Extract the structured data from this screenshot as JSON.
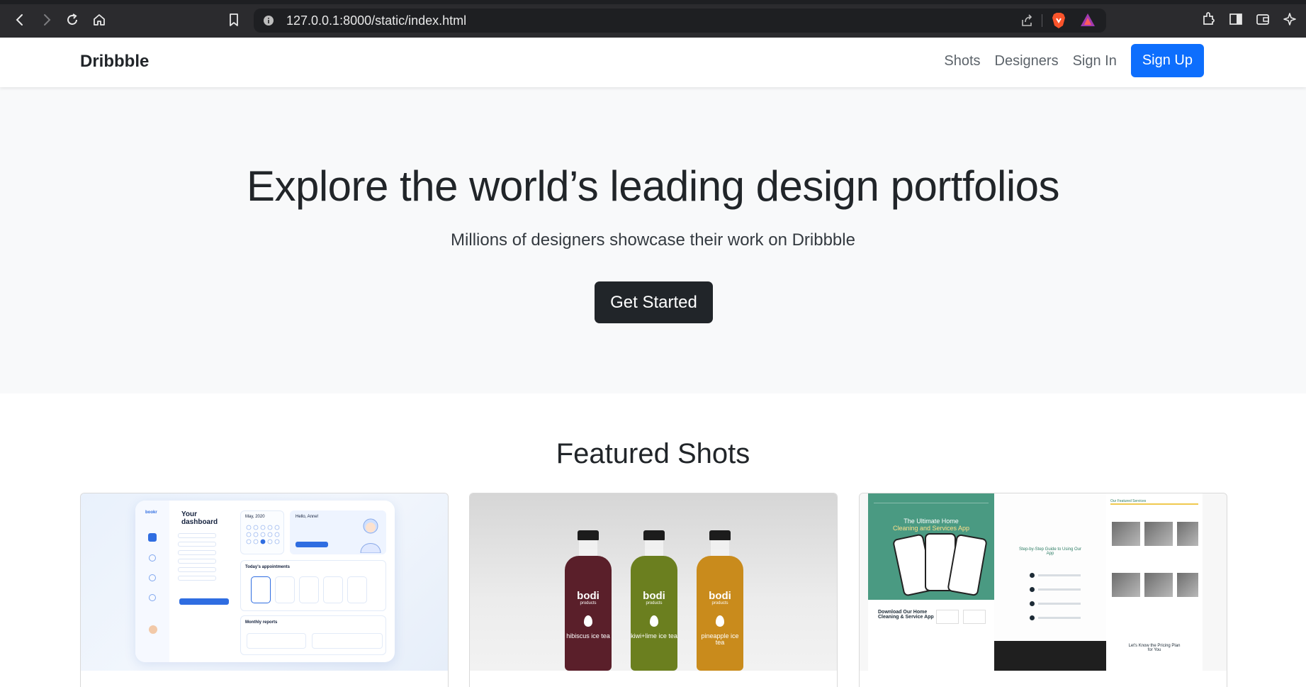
{
  "browser": {
    "url": "127.0.0.1:8000/static/index.html"
  },
  "navbar": {
    "brand": "Dribbble",
    "links": [
      "Shots",
      "Designers",
      "Sign In"
    ],
    "signup_label": "Sign Up"
  },
  "hero": {
    "title": "Explore the world’s leading design portfolios",
    "subtitle": "Millions of designers showcase their work on Dribbble",
    "cta_label": "Get Started"
  },
  "featured": {
    "title": "Featured Shots",
    "cards": [
      {
        "mock": {
          "heading": "Your dashboard",
          "calendar_label": "May, 2020",
          "greeting": "Hello, Anne!",
          "appointments_label": "Today's appointments",
          "reports_label": "Monthly reports"
        }
      },
      {
        "mock": {
          "bottles": [
            {
              "brand": "bodi",
              "sub": "products",
              "flavor": "hibiscus ice tea",
              "color": "#5a1f2a"
            },
            {
              "brand": "bodi",
              "sub": "products",
              "flavor": "kiwi+lime ice tea",
              "color": "#6b7f1f"
            },
            {
              "brand": "bodi",
              "sub": "products",
              "flavor": "pineapple ice tea",
              "color": "#c98b1c"
            }
          ]
        }
      },
      {
        "mock": {
          "hero_line1": "The Ultimate Home",
          "hero_line2": "Cleaning and Services App",
          "download_text": "Download Our Home Cleaning & Service App",
          "steps_title": "Step-by-Step Guide to Using Our App",
          "services_title": "Our Featured Services",
          "pricing_text": "Let's Know the Pricing Plan for You"
        }
      }
    ]
  },
  "colors": {
    "primary": "#0d6efd",
    "dark": "#212529",
    "hero_bg": "#f8f9fa",
    "chrome_bg": "#2b2b2e"
  }
}
